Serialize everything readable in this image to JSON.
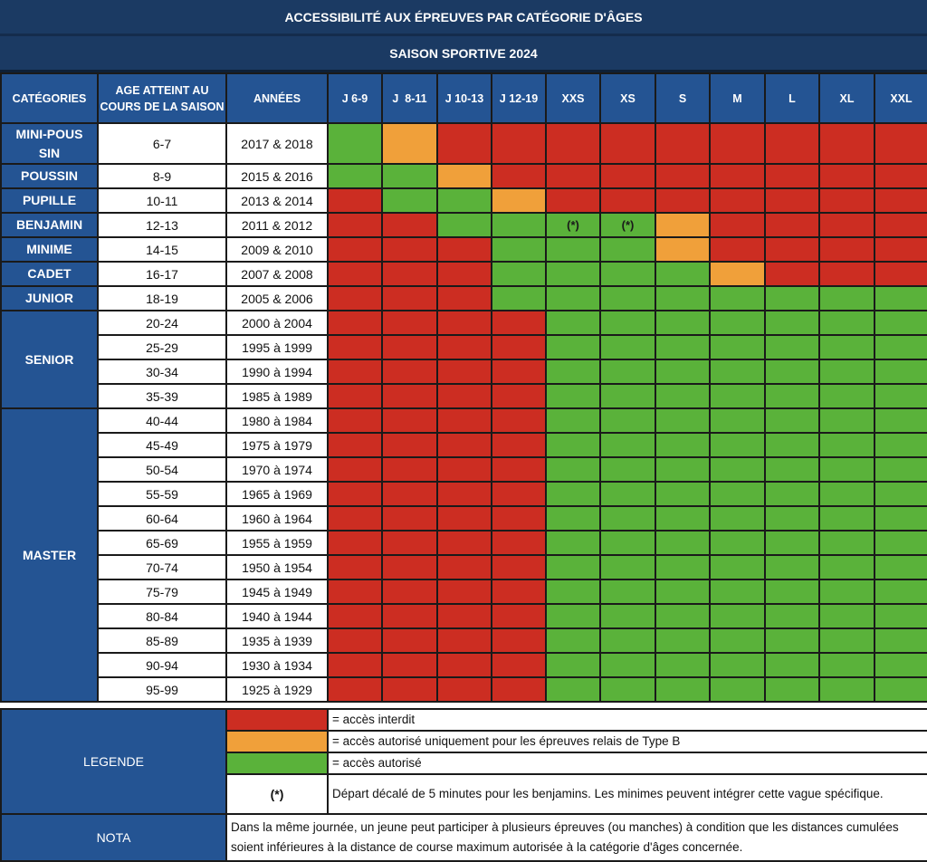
{
  "title": "ACCESSIBILITÉ AUX ÉPREUVES PAR CATÉGORIE D'ÂGES",
  "subtitle": "SAISON SPORTIVE 2024",
  "headers": {
    "categories": "CATÉGORIES",
    "age": "AGE ATTEINT AU COURS DE LA SAISON",
    "years": "ANNÉES",
    "races": [
      "J 6-9",
      "J  8-11",
      "J 10-13",
      "J 12-19",
      "XXS",
      "XS",
      "S",
      "M",
      "L",
      "XL",
      "XXL"
    ]
  },
  "colors": {
    "R": "#cc2d22",
    "O": "#f0a03a",
    "G": "#5ab23a",
    "header_blue": "#245493",
    "title_blue": "#1b3a63"
  },
  "categories": [
    {
      "name": "MINI-POUSSIN",
      "rows": [
        {
          "age": "6-7",
          "years": "2017 & 2018",
          "access": [
            "G",
            "O",
            "R",
            "R",
            "R",
            "R",
            "R",
            "R",
            "R",
            "R",
            "R"
          ],
          "notes": [
            "",
            "",
            "",
            "",
            "",
            "",
            "",
            "",
            "",
            "",
            ""
          ]
        }
      ]
    },
    {
      "name": "POUSSIN",
      "rows": [
        {
          "age": "8-9",
          "years": "2015 & 2016",
          "access": [
            "G",
            "G",
            "O",
            "R",
            "R",
            "R",
            "R",
            "R",
            "R",
            "R",
            "R"
          ],
          "notes": [
            "",
            "",
            "",
            "",
            "",
            "",
            "",
            "",
            "",
            "",
            ""
          ]
        }
      ]
    },
    {
      "name": "PUPILLE",
      "rows": [
        {
          "age": "10-11",
          "years": "2013 & 2014",
          "access": [
            "R",
            "G",
            "G",
            "O",
            "R",
            "R",
            "R",
            "R",
            "R",
            "R",
            "R"
          ],
          "notes": [
            "",
            "",
            "",
            "",
            "",
            "",
            "",
            "",
            "",
            "",
            ""
          ]
        }
      ]
    },
    {
      "name": "BENJAMIN",
      "rows": [
        {
          "age": "12-13",
          "years": "2011 & 2012",
          "access": [
            "R",
            "R",
            "G",
            "G",
            "G",
            "G",
            "O",
            "R",
            "R",
            "R",
            "R"
          ],
          "notes": [
            "",
            "",
            "",
            "",
            "(*)",
            "(*)",
            "",
            "",
            "",
            "",
            ""
          ]
        }
      ]
    },
    {
      "name": "MINIME",
      "rows": [
        {
          "age": "14-15",
          "years": "2009 & 2010",
          "access": [
            "R",
            "R",
            "R",
            "G",
            "G",
            "G",
            "O",
            "R",
            "R",
            "R",
            "R"
          ],
          "notes": [
            "",
            "",
            "",
            "",
            "",
            "",
            "",
            "",
            "",
            "",
            ""
          ]
        }
      ]
    },
    {
      "name": "CADET",
      "rows": [
        {
          "age": "16-17",
          "years": "2007 & 2008",
          "access": [
            "R",
            "R",
            "R",
            "G",
            "G",
            "G",
            "G",
            "O",
            "R",
            "R",
            "R"
          ],
          "notes": [
            "",
            "",
            "",
            "",
            "",
            "",
            "",
            "",
            "",
            "",
            ""
          ]
        }
      ]
    },
    {
      "name": "JUNIOR",
      "rows": [
        {
          "age": "18-19",
          "years": "2005 & 2006",
          "access": [
            "R",
            "R",
            "R",
            "G",
            "G",
            "G",
            "G",
            "G",
            "G",
            "G",
            "G"
          ],
          "notes": [
            "",
            "",
            "",
            "",
            "",
            "",
            "",
            "",
            "",
            "",
            ""
          ]
        }
      ]
    },
    {
      "name": "SENIOR",
      "rows": [
        {
          "age": "20-24",
          "years": "2000 à 2004",
          "access": [
            "R",
            "R",
            "R",
            "R",
            "G",
            "G",
            "G",
            "G",
            "G",
            "G",
            "G"
          ],
          "notes": [
            "",
            "",
            "",
            "",
            "",
            "",
            "",
            "",
            "",
            "",
            ""
          ]
        },
        {
          "age": "25-29",
          "years": "1995 à 1999",
          "access": [
            "R",
            "R",
            "R",
            "R",
            "G",
            "G",
            "G",
            "G",
            "G",
            "G",
            "G"
          ],
          "notes": [
            "",
            "",
            "",
            "",
            "",
            "",
            "",
            "",
            "",
            "",
            ""
          ]
        },
        {
          "age": "30-34",
          "years": "1990 à 1994",
          "access": [
            "R",
            "R",
            "R",
            "R",
            "G",
            "G",
            "G",
            "G",
            "G",
            "G",
            "G"
          ],
          "notes": [
            "",
            "",
            "",
            "",
            "",
            "",
            "",
            "",
            "",
            "",
            ""
          ]
        },
        {
          "age": "35-39",
          "years": "1985 à 1989",
          "access": [
            "R",
            "R",
            "R",
            "R",
            "G",
            "G",
            "G",
            "G",
            "G",
            "G",
            "G"
          ],
          "notes": [
            "",
            "",
            "",
            "",
            "",
            "",
            "",
            "",
            "",
            "",
            ""
          ]
        }
      ]
    },
    {
      "name": "MASTER",
      "rows": [
        {
          "age": "40-44",
          "years": "1980 à 1984",
          "access": [
            "R",
            "R",
            "R",
            "R",
            "G",
            "G",
            "G",
            "G",
            "G",
            "G",
            "G"
          ],
          "notes": [
            "",
            "",
            "",
            "",
            "",
            "",
            "",
            "",
            "",
            "",
            ""
          ]
        },
        {
          "age": "45-49",
          "years": "1975 à 1979",
          "access": [
            "R",
            "R",
            "R",
            "R",
            "G",
            "G",
            "G",
            "G",
            "G",
            "G",
            "G"
          ],
          "notes": [
            "",
            "",
            "",
            "",
            "",
            "",
            "",
            "",
            "",
            "",
            ""
          ]
        },
        {
          "age": "50-54",
          "years": "1970 à 1974",
          "access": [
            "R",
            "R",
            "R",
            "R",
            "G",
            "G",
            "G",
            "G",
            "G",
            "G",
            "G"
          ],
          "notes": [
            "",
            "",
            "",
            "",
            "",
            "",
            "",
            "",
            "",
            "",
            ""
          ]
        },
        {
          "age": "55-59",
          "years": "1965 à 1969",
          "access": [
            "R",
            "R",
            "R",
            "R",
            "G",
            "G",
            "G",
            "G",
            "G",
            "G",
            "G"
          ],
          "notes": [
            "",
            "",
            "",
            "",
            "",
            "",
            "",
            "",
            "",
            "",
            ""
          ]
        },
        {
          "age": "60-64",
          "years": "1960 à 1964",
          "access": [
            "R",
            "R",
            "R",
            "R",
            "G",
            "G",
            "G",
            "G",
            "G",
            "G",
            "G"
          ],
          "notes": [
            "",
            "",
            "",
            "",
            "",
            "",
            "",
            "",
            "",
            "",
            ""
          ]
        },
        {
          "age": "65-69",
          "years": "1955 à 1959",
          "access": [
            "R",
            "R",
            "R",
            "R",
            "G",
            "G",
            "G",
            "G",
            "G",
            "G",
            "G"
          ],
          "notes": [
            "",
            "",
            "",
            "",
            "",
            "",
            "",
            "",
            "",
            "",
            ""
          ]
        },
        {
          "age": "70-74",
          "years": "1950 à 1954",
          "access": [
            "R",
            "R",
            "R",
            "R",
            "G",
            "G",
            "G",
            "G",
            "G",
            "G",
            "G"
          ],
          "notes": [
            "",
            "",
            "",
            "",
            "",
            "",
            "",
            "",
            "",
            "",
            ""
          ]
        },
        {
          "age": "75-79",
          "years": "1945 à 1949",
          "access": [
            "R",
            "R",
            "R",
            "R",
            "G",
            "G",
            "G",
            "G",
            "G",
            "G",
            "G"
          ],
          "notes": [
            "",
            "",
            "",
            "",
            "",
            "",
            "",
            "",
            "",
            "",
            ""
          ]
        },
        {
          "age": "80-84",
          "years": "1940 à 1944",
          "access": [
            "R",
            "R",
            "R",
            "R",
            "G",
            "G",
            "G",
            "G",
            "G",
            "G",
            "G"
          ],
          "notes": [
            "",
            "",
            "",
            "",
            "",
            "",
            "",
            "",
            "",
            "",
            ""
          ]
        },
        {
          "age": "85-89",
          "years": "1935 à 1939",
          "access": [
            "R",
            "R",
            "R",
            "R",
            "G",
            "G",
            "G",
            "G",
            "G",
            "G",
            "G"
          ],
          "notes": [
            "",
            "",
            "",
            "",
            "",
            "",
            "",
            "",
            "",
            "",
            ""
          ]
        },
        {
          "age": "90-94",
          "years": "1930 à 1934",
          "access": [
            "R",
            "R",
            "R",
            "R",
            "G",
            "G",
            "G",
            "G",
            "G",
            "G",
            "G"
          ],
          "notes": [
            "",
            "",
            "",
            "",
            "",
            "",
            "",
            "",
            "",
            "",
            ""
          ]
        },
        {
          "age": "95-99",
          "years": "1925 à 1929",
          "access": [
            "R",
            "R",
            "R",
            "R",
            "G",
            "G",
            "G",
            "G",
            "G",
            "G",
            "G"
          ],
          "notes": [
            "",
            "",
            "",
            "",
            "",
            "",
            "",
            "",
            "",
            "",
            ""
          ]
        }
      ]
    }
  ],
  "legend": {
    "label": "LEGENDE",
    "items": [
      {
        "color": "R",
        "text": "= accès interdit"
      },
      {
        "color": "O",
        "text": "= accès autorisé uniquement pour les  épreuves relais de Type B"
      },
      {
        "color": "G",
        "text": "= accès autorisé"
      }
    ],
    "footnote": {
      "mark": "(*)",
      "text": "Départ décalé de 5 minutes pour les benjamins. Les minimes peuvent intégrer cette vague spécifique."
    }
  },
  "nota": {
    "label": "NOTA",
    "text": "Dans la même journée, un jeune peut participer à plusieurs épreuves (ou manches) à condition que les distances cumulées soient inférieures à la distance de course maximum autorisée à la catégorie d'âges concernée."
  }
}
